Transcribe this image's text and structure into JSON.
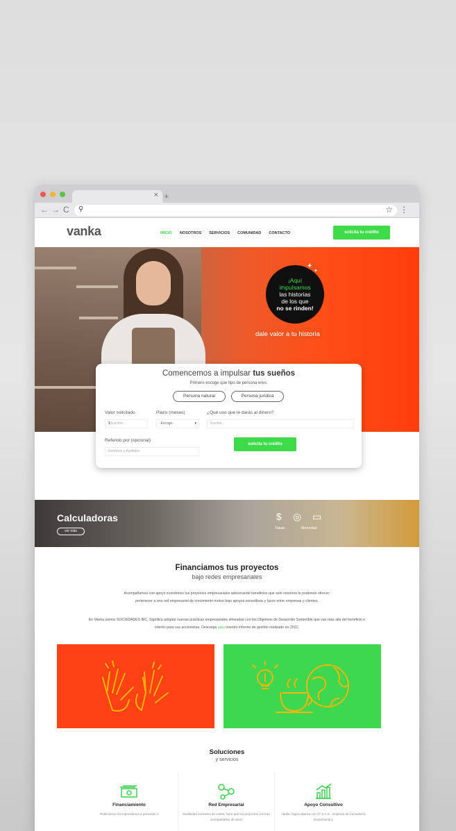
{
  "browser": {
    "tab_close": "×",
    "new_tab": "+",
    "back": "←",
    "forward": "→",
    "reload": "C",
    "search_glyph": "⚲",
    "bookmark_glyph": "☆",
    "menu_glyph": "⋮"
  },
  "site": {
    "logo": "vanka",
    "nav": [
      "INICIO",
      "NOSOTROS",
      "SERVICIOS",
      "COMUNIDAD",
      "CONTACTO"
    ],
    "header_cta": "solicita tu crédito"
  },
  "hero": {
    "badge_line1": "¡Aquí",
    "badge_line2": "impulsamos",
    "badge_line3": "las historias",
    "badge_line4": "de los que",
    "badge_line5": "no se rinden!",
    "tagline": "dale valor a tu historia"
  },
  "form": {
    "title_plain": "Comencemos a impulsar ",
    "title_bold": "tus sueños",
    "subtitle": "Primero escoge que tipo de persona eres:",
    "option_natural": "Persona natural",
    "option_juridica": "Persona jurídica",
    "label_valor": "Valor solicitado",
    "label_plazo": "Plazo (meses)",
    "label_uso": "¿Qué uso que le darás al dinero?",
    "label_referido": "Referido por (opcional)",
    "currency": "$",
    "placeholder_valor": "Escribe...",
    "placeholder_plazo": "-Escoge-",
    "placeholder_uso": "Escribe...",
    "placeholder_referido": "Nombres y Apellidos",
    "submit": "solicita tu crédito"
  },
  "calc": {
    "title": "Calculadoras",
    "button": "ver más",
    "label_tasas": "Tasas",
    "label_monedas": "Monedas"
  },
  "financiamos": {
    "title": "Financiamos tus proyectos",
    "subtitle": "bajo redes empresariales",
    "para1": "Acompañamos con apoyo económico tus proyectos empresariales adicionando beneficios que solo nosotros te podemos ofrecer;",
    "para1b": "pertenecer a una red empresarial de crecimiento mutuo bajo apoyos consultivos y lazos entre empresas y clientes.",
    "para2": "En Vanka somos SOCIEDADES BIC. Significa adoptar nuevas prácticas empresariales alineadas con los Objetivos de Desarrollo Sostenible que van más allá del beneficio e",
    "para2b_pre": "interés para sus accionistas. Descarga ",
    "para2b_link": "aquí",
    "para2b_post": " nuestro informe de gestión realizado en 2021."
  },
  "soluciones": {
    "title": "Soluciones",
    "subtitle": "y servicios",
    "items": [
      {
        "name": "Financiamiento",
        "desc": "Realizamos microprestamos a personas o"
      },
      {
        "name": "Red Empresarial",
        "desc": "Modalidad exclusiva de vanka, hace que los proyectos crezcan acompañados de otros"
      },
      {
        "name": "Apoyo Consultivo",
        "desc": "vanka, lógica alianza con 17 S.A.S., empresa de Consultoría Empresarial y"
      }
    ]
  },
  "colors": {
    "accent_green": "#3ddb4a",
    "hero_orange": "#ff4216",
    "panel_green": "#3ed850"
  }
}
